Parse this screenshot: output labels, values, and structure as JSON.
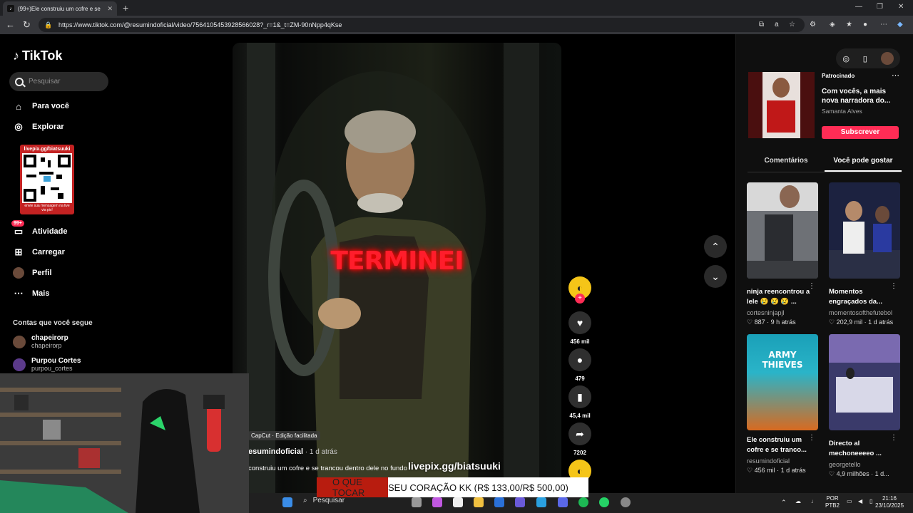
{
  "browser": {
    "tab_title": "(99+)Ele construiu um cofre e se",
    "url": "https://www.tiktok.com/@resumindoficial/video/7564105453928566028?_r=1&_t=ZM-90nNpp4qKse"
  },
  "sidebar": {
    "logo": "TikTok",
    "search_placeholder": "Pesquisar",
    "items": [
      {
        "label": "Para você",
        "icon": "home-icon"
      },
      {
        "label": "Explorar",
        "icon": "compass-icon"
      },
      {
        "label": "Atividade",
        "icon": "inbox-icon",
        "badge": "99+"
      },
      {
        "label": "Carregar",
        "icon": "upload-icon"
      },
      {
        "label": "Perfil",
        "icon": "avatar-icon"
      },
      {
        "label": "Mais",
        "icon": "more-icon"
      }
    ],
    "following_title": "Contas que você segue",
    "following": [
      {
        "name": "chapeirorp",
        "handle": "chapeirorp"
      },
      {
        "name": "Purpou Cortes",
        "handle": "purpou_cortes"
      }
    ]
  },
  "qr_overlay": {
    "title": "livepix.gg/biatsuuki",
    "bottom": "envie sua mensagem na live via pix!"
  },
  "video": {
    "overlay_text": "TERMINEI",
    "capcut": "CapCut · Edição facilitada",
    "author": "esumindoficial",
    "time": " · 1 d atrás",
    "description": "construiu um cofre e se trancou dentro dele no fundo",
    "livepix": "livepix.gg/biatsuuki"
  },
  "actions": {
    "likes": "456 mil",
    "comments": "479",
    "saves": "45,4 mil",
    "shares": "7202"
  },
  "right_panel": {
    "ad": {
      "label": "Patrocinado",
      "title": "Com vocês, a mais nova narradora do...",
      "author": "Samanta Alves",
      "button": "Subscrever"
    },
    "tabs": [
      "Comentários",
      "Você pode gostar"
    ],
    "cards": [
      {
        "title": "ninja reencontrou a lele 😢 😢 😢 ...",
        "author": "cortesninjapjl",
        "likes": "887",
        "time": "9 h atrás"
      },
      {
        "title": "Momentos engraçados da...",
        "author": "momentosofthefutebol",
        "likes": "202,9 mil",
        "time": "1 d atrás"
      },
      {
        "title": "Ele construiu um cofre e se tranco...",
        "author": "resumindoficial",
        "likes": "456 mil",
        "time": "1 d atrás"
      },
      {
        "title": "Directo al mechoneeeeo ...",
        "author": "georgetello",
        "likes": "4,9 milhões",
        "time": "1 d..."
      }
    ],
    "thumb_text": "ARMY THIEVES"
  },
  "donation": {
    "red_part": "O QUE TOCAR",
    "rest": " SEU CORAÇÃO KK (R$ 133,00/R$ 500,00)"
  },
  "taskbar": {
    "search": "Pesquisar",
    "lang": "POR",
    "lang2": "PTB2",
    "time": "21:16",
    "date": "23/10/2025"
  }
}
